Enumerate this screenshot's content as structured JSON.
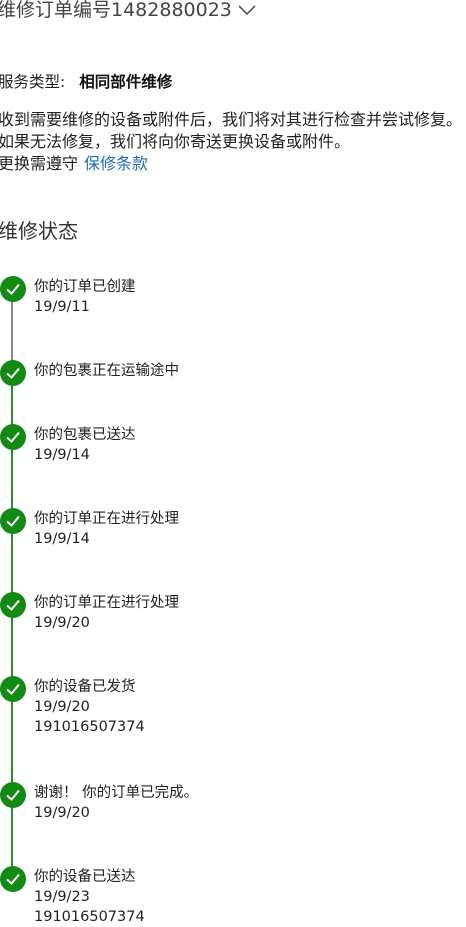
{
  "header": {
    "title": "维修订单编号1482880023",
    "chevron_icon": "chevron-down-icon"
  },
  "service": {
    "label": "服务类型:",
    "value": "相同部件维修"
  },
  "description": {
    "text": "收到需要维修的设备或附件后，我们将对其进行检查并尝试修复。 如果无法修复，我们将向你寄送更换设备或附件。",
    "warranty_prefix": "更换需遵守",
    "warranty_link": "保修条款"
  },
  "status": {
    "title": "维修状态",
    "steps": [
      {
        "title": "你的订单已创建",
        "date": "19/9/11",
        "tracking": ""
      },
      {
        "title": "你的包裹正在运输途中",
        "date": "",
        "tracking": ""
      },
      {
        "title": "你的包裹已送达",
        "date": "19/9/14",
        "tracking": ""
      },
      {
        "title": "你的订单正在进行处理",
        "date": "19/9/14",
        "tracking": ""
      },
      {
        "title": "你的订单正在进行处理",
        "date": "19/9/20",
        "tracking": ""
      },
      {
        "title": "你的设备已发货",
        "date": "19/9/20",
        "tracking": "191016507374"
      },
      {
        "title": "谢谢！ 你的订单已完成。",
        "date": "19/9/20",
        "tracking": ""
      },
      {
        "title": "你的设备已送达",
        "date": "19/9/23",
        "tracking": "191016507374"
      }
    ]
  },
  "colors": {
    "check_green": "#138a13",
    "line_green": "#2e8b2e",
    "line_gray": "#8a8a8a",
    "link_blue": "#1e6fbf"
  }
}
